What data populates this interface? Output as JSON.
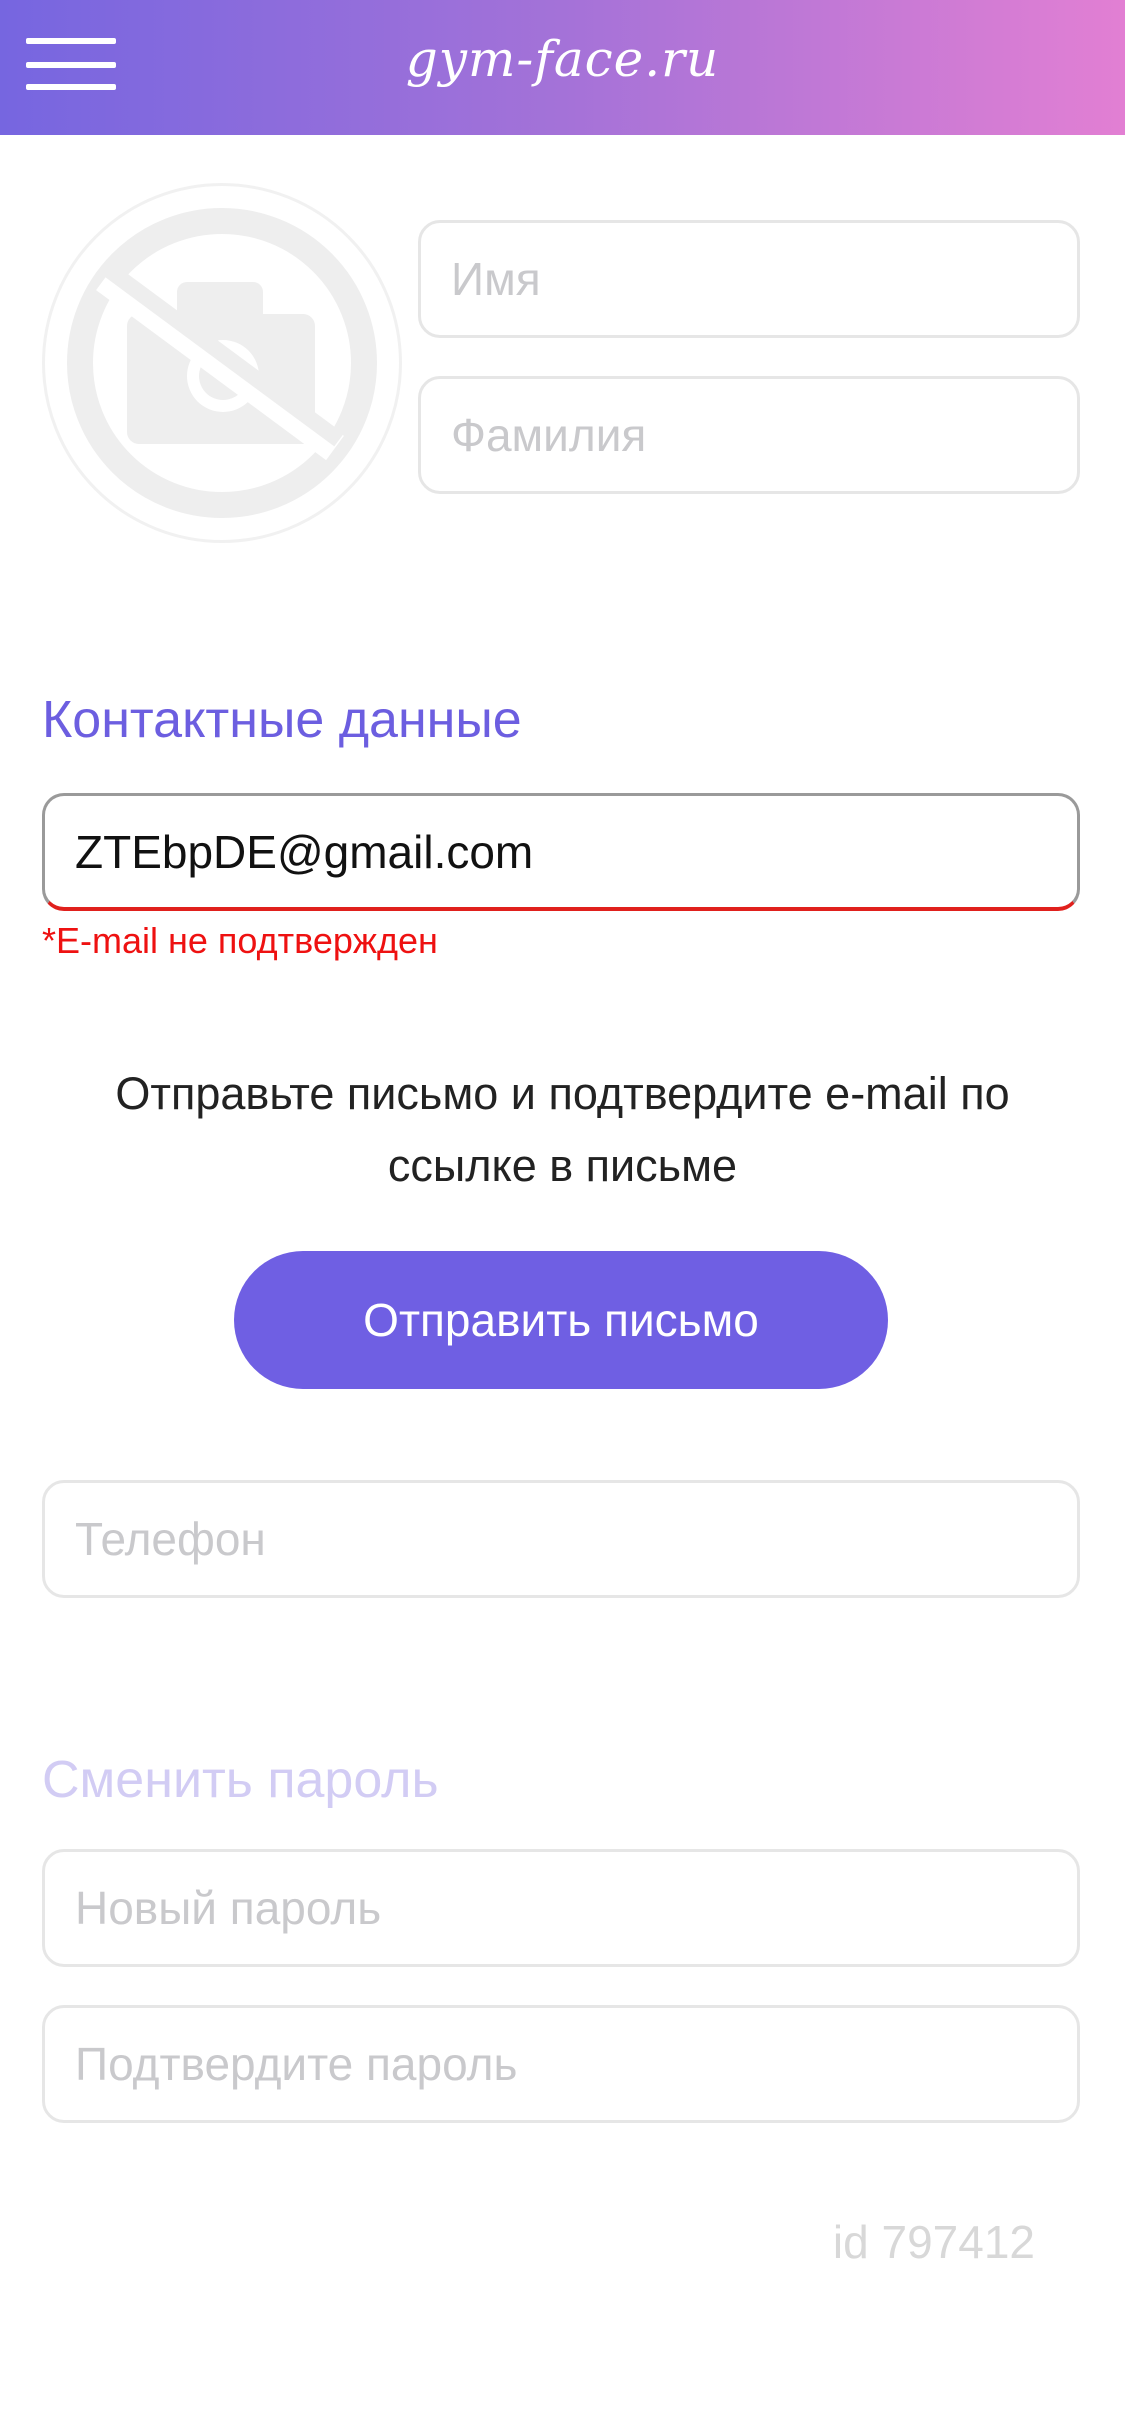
{
  "header": {
    "site_name": "gym-face.ru",
    "gradient_start": "#7666e0",
    "gradient_end": "#e27fd3",
    "menu_icon": "hamburger-menu-icon"
  },
  "profile": {
    "avatar_icon": "no-photo-camera-icon",
    "first_name": {
      "value": "",
      "placeholder": "Имя"
    },
    "last_name": {
      "value": "",
      "placeholder": "Фамилия"
    }
  },
  "contacts": {
    "title": "Контактные данные",
    "email": {
      "value": "ZTEbpDE@gmail.com",
      "placeholder": ""
    },
    "email_error": "*E-mail не подтвержден",
    "info_text": "Отправьте письмо и подтвердите e-mail по ссылке в письме",
    "send_button_label": "Отправить письмо",
    "phone": {
      "value": "",
      "placeholder": "Телефон"
    }
  },
  "password": {
    "title": "Сменить пароль",
    "new_password": {
      "value": "",
      "placeholder": "Новый пароль"
    },
    "confirm_password": {
      "value": "",
      "placeholder": "Подтвердите пароль"
    }
  },
  "user_id": "id 797412",
  "colors": {
    "accent": "#6f5fe3",
    "error": "#ee1111"
  }
}
